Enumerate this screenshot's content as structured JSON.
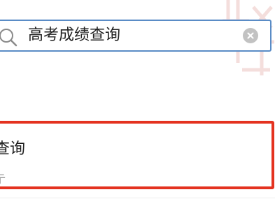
{
  "search": {
    "value": "高考成绩查询",
    "placeholder": "",
    "icon": "search-icon",
    "clear_icon": "clear-icon"
  },
  "result": {
    "title": "查询",
    "subtitle": "亍"
  },
  "colors": {
    "search_border": "#5a8cc6",
    "highlight_border": "#e4321f",
    "clear_button": "#c2c2c2",
    "subtitle_text": "#9a9a9a"
  }
}
